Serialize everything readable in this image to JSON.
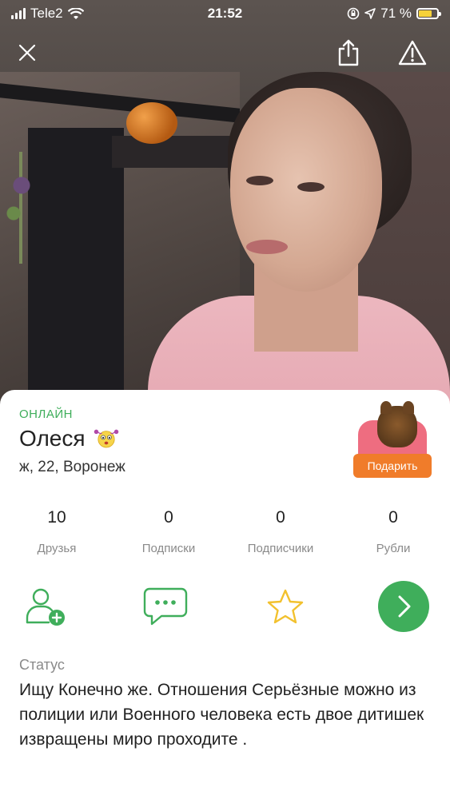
{
  "status_bar": {
    "carrier": "Tele2",
    "time": "21:52",
    "battery": "71 %",
    "battery_level": 0.71
  },
  "toolbar": {
    "close_icon": "close-icon",
    "share_icon": "share-icon",
    "report_icon": "warning-icon"
  },
  "profile": {
    "online_label": "ОНЛАЙН",
    "name": "Олеся",
    "name_badge_icon": "smiley-icon",
    "info": "ж, 22, Воронеж",
    "gift_label": "Подарить"
  },
  "stats": [
    {
      "value": "10",
      "label": "Друзья"
    },
    {
      "value": "0",
      "label": "Подписки"
    },
    {
      "value": "0",
      "label": "Подписчики"
    },
    {
      "value": "0",
      "label": "Рубли"
    }
  ],
  "actions": [
    {
      "icon": "add-friend-icon"
    },
    {
      "icon": "message-icon"
    },
    {
      "icon": "star-icon"
    },
    {
      "icon": "chevron-right-icon"
    }
  ],
  "colors": {
    "accent_green": "#3fae5b",
    "gift_orange": "#f07c2a",
    "star_yellow": "#f2c12e"
  },
  "status_section": {
    "label": "Статус",
    "text": "Ищу Конечно же. Отношения   Серьёзные можно из полиции или Военного человека есть двое дитишек   извращены миро проходите ."
  }
}
